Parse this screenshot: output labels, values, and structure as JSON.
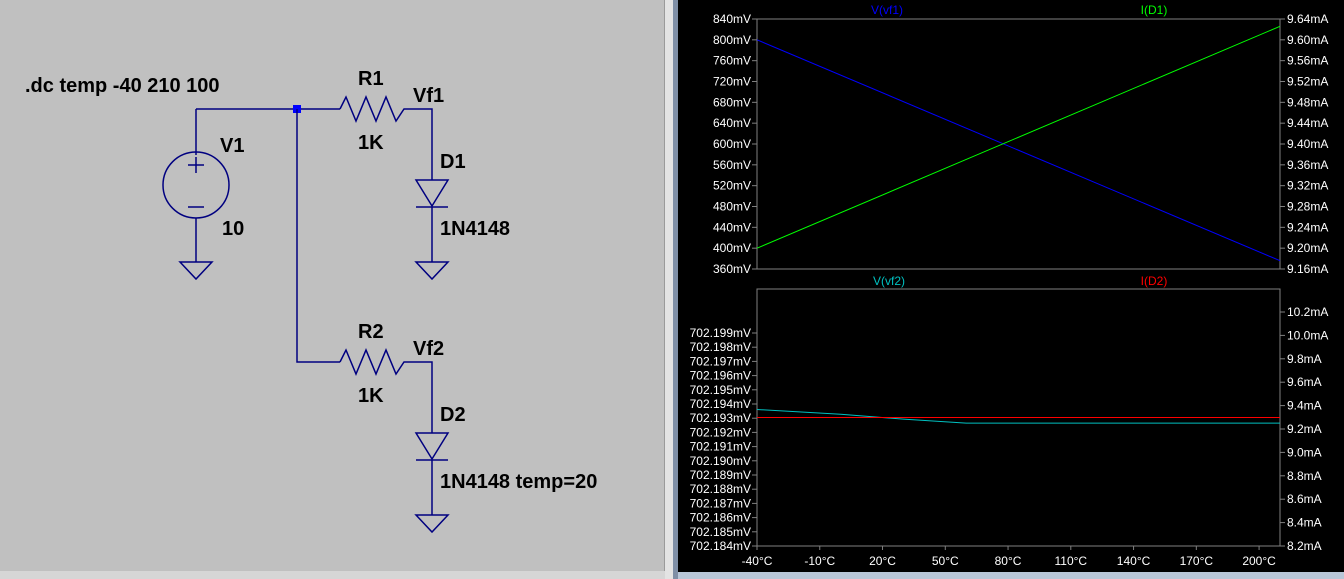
{
  "schematic": {
    "directive": ".dc temp -40 210 100",
    "source": {
      "name": "V1",
      "value": "10"
    },
    "r1": {
      "name": "R1",
      "value": "1K"
    },
    "r2": {
      "name": "R2",
      "value": "1K"
    },
    "vf1": "Vf1",
    "vf2": "Vf2",
    "d1": {
      "name": "D1",
      "model": "1N4148"
    },
    "d2": {
      "name": "D2",
      "model": "1N4148 temp=20"
    },
    "colors": {
      "background": "#c0c0c0",
      "wire": "#000080",
      "junction": "#0000ff"
    }
  },
  "chart_data": [
    {
      "type": "line",
      "pane": "top",
      "title": "",
      "x": [
        -40,
        210
      ],
      "series": [
        {
          "name": "V(vf1)",
          "axis": "left",
          "color": "#0000ff",
          "values": [
            800,
            376
          ]
        },
        {
          "name": "I(D1)",
          "axis": "right",
          "color": "#00ff00",
          "values": [
            9.2,
            9.626
          ]
        }
      ],
      "xlim": [
        -40,
        210
      ],
      "ylim_left": [
        360,
        840
      ],
      "ylim_right": [
        9.16,
        9.64
      ],
      "yticks_left": [
        "840mV",
        "800mV",
        "760mV",
        "720mV",
        "680mV",
        "640mV",
        "600mV",
        "560mV",
        "520mV",
        "480mV",
        "440mV",
        "400mV",
        "360mV"
      ],
      "yticks_right": [
        "9.64mA",
        "9.60mA",
        "9.56mA",
        "9.52mA",
        "9.48mA",
        "9.44mA",
        "9.40mA",
        "9.36mA",
        "9.32mA",
        "9.28mA",
        "9.24mA",
        "9.20mA",
        "9.16mA"
      ],
      "grid": false
    },
    {
      "type": "line",
      "pane": "bottom",
      "title": "",
      "x": [
        -40,
        0,
        30,
        60,
        210
      ],
      "series": [
        {
          "name": "V(vf2)",
          "axis": "left",
          "color": "#00c0c0",
          "values": [
            702.1925,
            702.1922,
            702.1919,
            702.19165,
            702.19165
          ]
        },
        {
          "name": "I(D2)",
          "axis": "right",
          "color": "#ff0000",
          "values": [
            9.3,
            9.3,
            9.3,
            9.3,
            9.3
          ]
        }
      ],
      "xlim": [
        -40,
        210
      ],
      "ylim_left": [
        702.184,
        702.2
      ],
      "ylim_right": [
        8.2,
        10.4
      ],
      "yticks_left": [
        "702.199mV",
        "702.198mV",
        "702.197mV",
        "702.196mV",
        "702.195mV",
        "702.194mV",
        "702.193mV",
        "702.192mV",
        "702.191mV",
        "702.190mV",
        "702.189mV",
        "702.188mV",
        "702.187mV",
        "702.186mV",
        "702.185mV",
        "702.184mV"
      ],
      "yticks_right": [
        "10.2mA",
        "10.0mA",
        "9.8mA",
        "9.6mA",
        "9.4mA",
        "9.2mA",
        "9.0mA",
        "8.8mA",
        "8.6mA",
        "8.4mA",
        "8.2mA"
      ],
      "xticks": [
        "-40°C",
        "-10°C",
        "20°C",
        "50°C",
        "80°C",
        "110°C",
        "140°C",
        "170°C",
        "200°C"
      ],
      "grid": false
    }
  ]
}
